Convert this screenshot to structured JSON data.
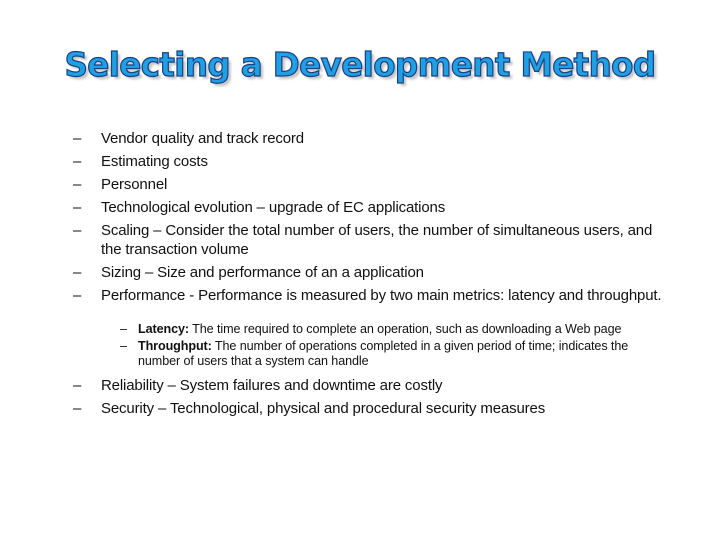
{
  "title": "Selecting a Development Method",
  "bullet_glyph": "–",
  "items_top": [
    {
      "text": "Vendor quality and track record"
    },
    {
      "text": "Estimating costs"
    },
    {
      "text": "Personnel"
    },
    {
      "text": "Technological evolution – upgrade of EC applications"
    },
    {
      "text": "Scaling – Consider the total number of users, the number of simultaneous users, and the transaction volume"
    },
    {
      "text": "Sizing – Size and performance of an a application"
    },
    {
      "text": "Performance - Performance is measured by two main metrics: latency and throughput."
    }
  ],
  "sub_items": [
    {
      "term": "Latency:",
      "text": " The time required to complete an operation, such as downloading a Web page"
    },
    {
      "term": "Throughput:",
      "text": " The number of operations completed in a given period of time; indicates the number of users that a system can handle"
    }
  ],
  "items_bottom": [
    {
      "text": "Reliability – System failures and downtime are costly"
    },
    {
      "text": "Security – Technological, physical and procedural security measures"
    }
  ],
  "colors": {
    "title_fill": "#1ea0e2",
    "title_outline": "#1b3f86",
    "text": "#111111"
  }
}
